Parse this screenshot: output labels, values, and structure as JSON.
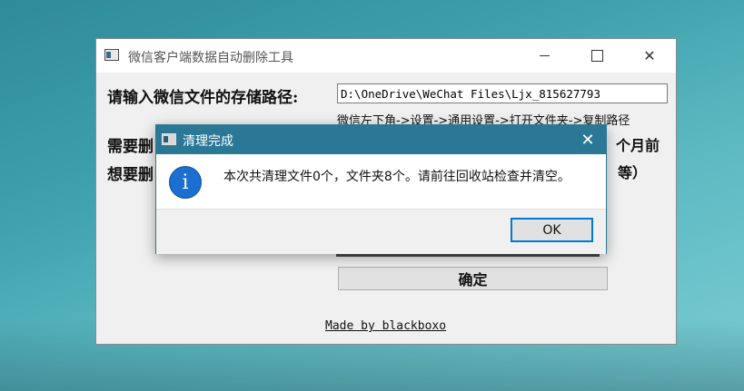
{
  "main_window": {
    "title": "微信客户端数据自动删除工具",
    "label_path": "请输入微信文件的存储路径:",
    "path_value": "D:\\OneDrive\\WeChat Files\\Ljx_815627793",
    "path_hint": "微信左下角->设置->通用设置->打开文件夹->复制路径",
    "label_months_partial": "需要删",
    "label_types_partial": "想要删",
    "months_suffix": "个月前",
    "types_suffix": "等）",
    "confirm_label": "确定",
    "credit": "Made by blackboxo"
  },
  "dialog": {
    "title": "清理完成",
    "message": "本次共清理文件0个，文件夹8个。请前往回收站检查并清空。",
    "ok_label": "OK",
    "icon": "info-icon"
  },
  "colors": {
    "dialog_titlebar": "#2b7896",
    "info_icon": "#1a6fd0",
    "ok_border": "#0078d7"
  }
}
